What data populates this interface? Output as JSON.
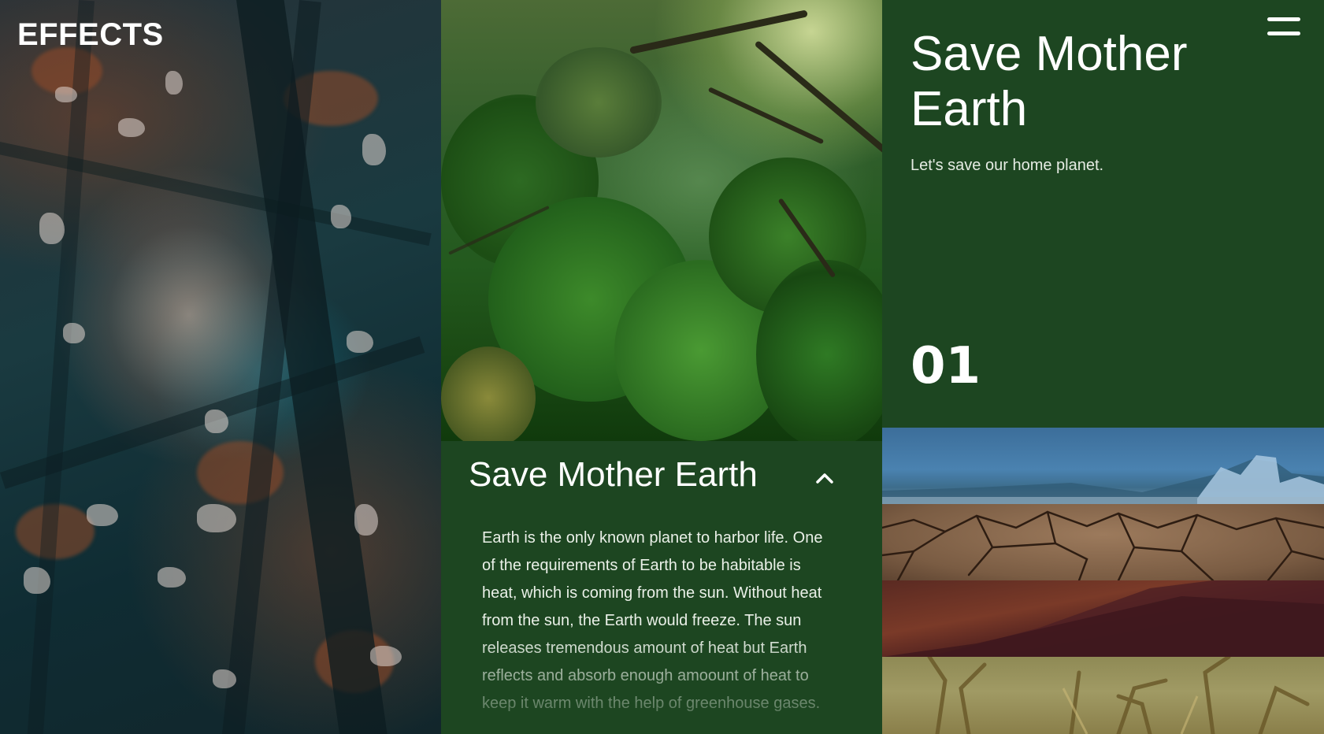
{
  "brand": {
    "logo": "EFFECTS"
  },
  "feature": {
    "title": "Save Mother Earth",
    "body": "Earth is the only known planet to harbor life. One of the requirements of Earth to be habitable is heat, which is coming from the sun. Without heat from the sun, the Earth would freeze. The sun releases tremendous amount of heat but Earth reflects and absorb enough amoount of heat to keep it warm with the help of greenhouse gases.",
    "toggle_icon": "chevron-up-icon"
  },
  "slide": {
    "title": "Save Mother Earth",
    "subtitle": "Let's save our home planet.",
    "number": "01"
  },
  "menu": {
    "icon": "hamburger-menu-icon"
  },
  "thumbnails": [
    {
      "name": "glacier-sky-thumbnail"
    },
    {
      "name": "cracked-earth-thumbnail"
    },
    {
      "name": "red-hill-thumbnail"
    },
    {
      "name": "dry-cornfield-thumbnail"
    }
  ],
  "colors": {
    "panel_green": "#1d4621",
    "text_white": "#ffffff"
  }
}
